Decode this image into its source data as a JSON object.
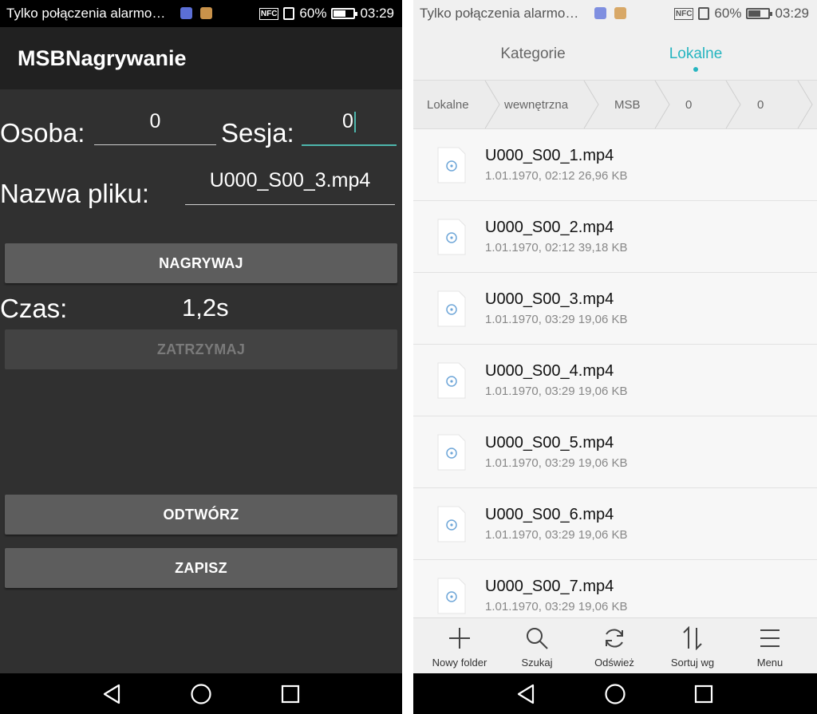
{
  "left": {
    "status": {
      "notification": "Tylko połączenia alarmo…",
      "nfc": "NFC",
      "battery_pct": "60%",
      "battery_level": 0.6,
      "time": "03:29"
    },
    "app_title": "MSBNagrywanie",
    "osoba": {
      "label": "Osoba:",
      "value": "0"
    },
    "sesja": {
      "label": "Sesja:",
      "value": "0"
    },
    "filename": {
      "label": "Nazwa pliku:",
      "value": "U000_S00_3.mp4"
    },
    "record_button": "NAGRYWAJ",
    "time": {
      "label": "Czas:",
      "value": "1,2s"
    },
    "stop_button": "ZATRZYMAJ",
    "play_button": "ODTWÓRZ",
    "save_button": "ZAPISZ"
  },
  "right": {
    "status": {
      "notification": "Tylko połączenia alarmo…",
      "nfc": "NFC",
      "battery_pct": "60%",
      "battery_level": 0.6,
      "time": "03:29"
    },
    "tabs": [
      "Kategorie",
      "Lokalne"
    ],
    "active_tab": "Lokalne",
    "breadcrumbs": [
      "Lokalne",
      "wewnętrzna",
      "MSB",
      "0",
      "0"
    ],
    "files": [
      {
        "name": "U000_S00_1.mp4",
        "meta": "1.01.1970, 02:12 26,96 KB"
      },
      {
        "name": "U000_S00_2.mp4",
        "meta": "1.01.1970, 02:12 39,18 KB"
      },
      {
        "name": "U000_S00_3.mp4",
        "meta": "1.01.1970, 03:29 19,06 KB"
      },
      {
        "name": "U000_S00_4.mp4",
        "meta": "1.01.1970, 03:29 19,06 KB"
      },
      {
        "name": "U000_S00_5.mp4",
        "meta": "1.01.1970, 03:29 19,06 KB"
      },
      {
        "name": "U000_S00_6.mp4",
        "meta": "1.01.1970, 03:29 19,06 KB"
      },
      {
        "name": "U000_S00_7.mp4",
        "meta": "1.01.1970, 03:29 19,06 KB"
      }
    ],
    "toolbar": [
      {
        "label": "Nowy folder",
        "icon": "plus-icon"
      },
      {
        "label": "Szukaj",
        "icon": "search-icon"
      },
      {
        "label": "Odśwież",
        "icon": "refresh-icon"
      },
      {
        "label": "Sortuj wg",
        "icon": "sort-icon"
      },
      {
        "label": "Menu",
        "icon": "menu-icon"
      }
    ]
  },
  "colors": {
    "accent": "#26b5c0",
    "field_focus": "#4db6ac",
    "app_bg": "#303030",
    "button": "#5d5d5d"
  }
}
